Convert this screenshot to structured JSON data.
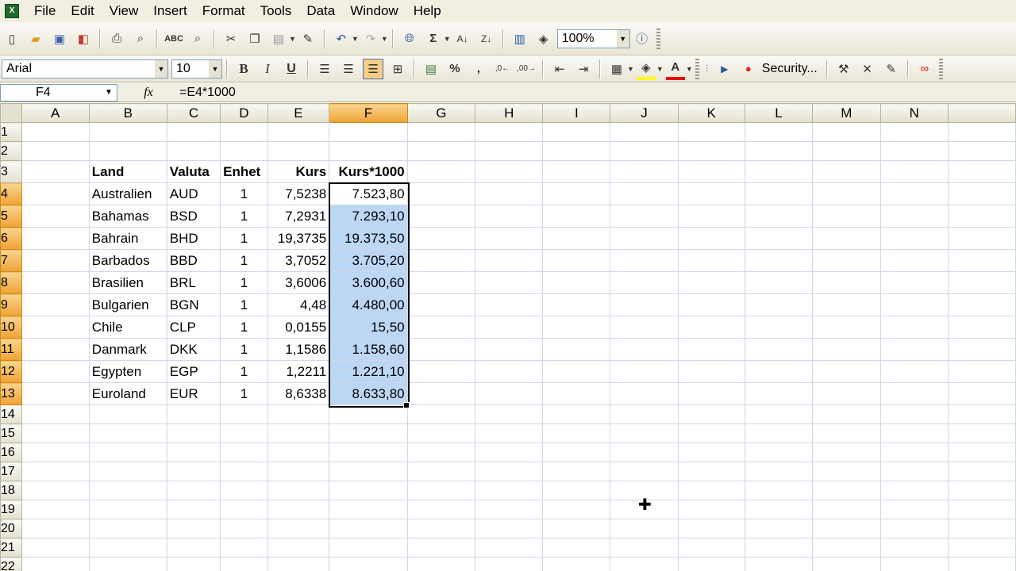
{
  "menu": [
    "File",
    "Edit",
    "View",
    "Insert",
    "Format",
    "Tools",
    "Data",
    "Window",
    "Help"
  ],
  "toolbar": {
    "zoom": "100%",
    "security_label": "Security..."
  },
  "format": {
    "font": "Arial",
    "size": "10"
  },
  "formula": {
    "namebox": "F4",
    "fx": "fx",
    "text": "=E4*1000"
  },
  "columns": [
    "A",
    "B",
    "C",
    "D",
    "E",
    "F",
    "G",
    "H",
    "I",
    "J",
    "K",
    "L",
    "M",
    "N"
  ],
  "rows": [
    {
      "n": "1",
      "cells": [
        "",
        "",
        "",
        "",
        "",
        ""
      ]
    },
    {
      "n": "2",
      "cells": [
        "",
        "",
        "",
        "",
        "",
        ""
      ]
    },
    {
      "n": "3",
      "cells": [
        "",
        "Land",
        "Valuta",
        "Enhet",
        "Kurs",
        "Kurs*1000"
      ]
    },
    {
      "n": "4",
      "cells": [
        "",
        "Australien",
        "AUD",
        "1",
        "7,5238",
        "7.523,80"
      ]
    },
    {
      "n": "5",
      "cells": [
        "",
        "Bahamas",
        "BSD",
        "1",
        "7,2931",
        "7.293,10"
      ]
    },
    {
      "n": "6",
      "cells": [
        "",
        "Bahrain",
        "BHD",
        "1",
        "19,3735",
        "19.373,50"
      ]
    },
    {
      "n": "7",
      "cells": [
        "",
        "Barbados",
        "BBD",
        "1",
        "3,7052",
        "3.705,20"
      ]
    },
    {
      "n": "8",
      "cells": [
        "",
        "Brasilien",
        "BRL",
        "1",
        "3,6006",
        "3.600,60"
      ]
    },
    {
      "n": "9",
      "cells": [
        "",
        "Bulgarien",
        "BGN",
        "1",
        "4,48",
        "4.480,00"
      ]
    },
    {
      "n": "10",
      "cells": [
        "",
        "Chile",
        "CLP",
        "1",
        "0,0155",
        "15,50"
      ]
    },
    {
      "n": "11",
      "cells": [
        "",
        "Danmark",
        "DKK",
        "1",
        "1,1586",
        "1.158,60"
      ]
    },
    {
      "n": "12",
      "cells": [
        "",
        "Egypten",
        "EGP",
        "1",
        "1,2211",
        "1.221,10"
      ]
    },
    {
      "n": "13",
      "cells": [
        "",
        "Euroland",
        "EUR",
        "1",
        "8,6338",
        "8.633,80"
      ]
    },
    {
      "n": "14",
      "cells": [
        "",
        "",
        "",
        "",
        "",
        ""
      ]
    },
    {
      "n": "15",
      "cells": [
        "",
        "",
        "",
        "",
        "",
        ""
      ]
    },
    {
      "n": "16",
      "cells": [
        "",
        "",
        "",
        "",
        "",
        ""
      ]
    },
    {
      "n": "17",
      "cells": [
        "",
        "",
        "",
        "",
        "",
        ""
      ]
    },
    {
      "n": "18",
      "cells": [
        "",
        "",
        "",
        "",
        "",
        ""
      ]
    },
    {
      "n": "19",
      "cells": [
        "",
        "",
        "",
        "",
        "",
        ""
      ]
    },
    {
      "n": "20",
      "cells": [
        "",
        "",
        "",
        "",
        "",
        ""
      ]
    },
    {
      "n": "21",
      "cells": [
        "",
        "",
        "",
        "",
        "",
        ""
      ]
    },
    {
      "n": "22",
      "cells": [
        "",
        "",
        "",
        "",
        "",
        ""
      ]
    }
  ]
}
